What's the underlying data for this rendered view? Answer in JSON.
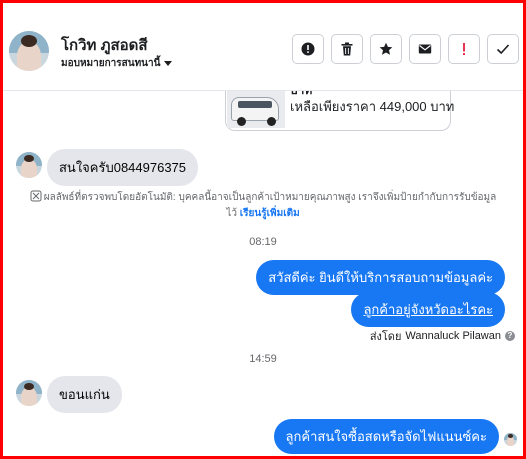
{
  "header": {
    "contact_name": "โกวิท ภูสอดสี",
    "assign_label": "มอบหมายการสนทนานี้",
    "toolbar": [
      {
        "name": "spam-button",
        "icon": "exclamation-circle-icon",
        "color": "#1c1e21"
      },
      {
        "name": "delete-button",
        "icon": "trash-icon",
        "color": "#1c1e21"
      },
      {
        "name": "star-button",
        "icon": "star-icon",
        "color": "#1c1e21"
      },
      {
        "name": "mark-unread-button",
        "icon": "envelope-icon",
        "color": "#1c1e21"
      },
      {
        "name": "follow-up-button",
        "icon": "exclamation-icon",
        "color": "#e41e3f"
      },
      {
        "name": "done-button",
        "icon": "check-icon",
        "color": "#1c1e21"
      }
    ]
  },
  "card": {
    "title": "บาท",
    "price": "เหลือเพียงราคา 449,000 บาท"
  },
  "messages": {
    "in1": "สนใจครับ0844976375",
    "notice_text": "ผลลัพธ์ที่ตรวจพบโดยอัตโนมัติ: บุคคลนี้อาจเป็นลูกค้าเป้าหมายคุณภาพสูง เราจึงเพิ่มป้ายกำกับการรับข้อมูลไว้",
    "notice_link": "เรียนรู้เพิ่มเติม",
    "time1": "08:19",
    "out1": "สวัสดีค่ะ  ยินดีให้บริการสอบถามข้อมูลค่ะ",
    "out2": "ลูกค้าอยู่จังหวัดอะไรคะ",
    "sent_by_label": "ส่งโดย",
    "sent_by_name": "Wannaluck Pilawan",
    "time2": "14:59",
    "in2": "ขอนแก่น",
    "out3": "ลูกค้าสนใจซื้อสดหรือจัดไฟแนนซ์คะ"
  },
  "colors": {
    "accent": "#1877f2",
    "frame": "#ff0000",
    "incoming_bubble": "#e4e6eb"
  }
}
